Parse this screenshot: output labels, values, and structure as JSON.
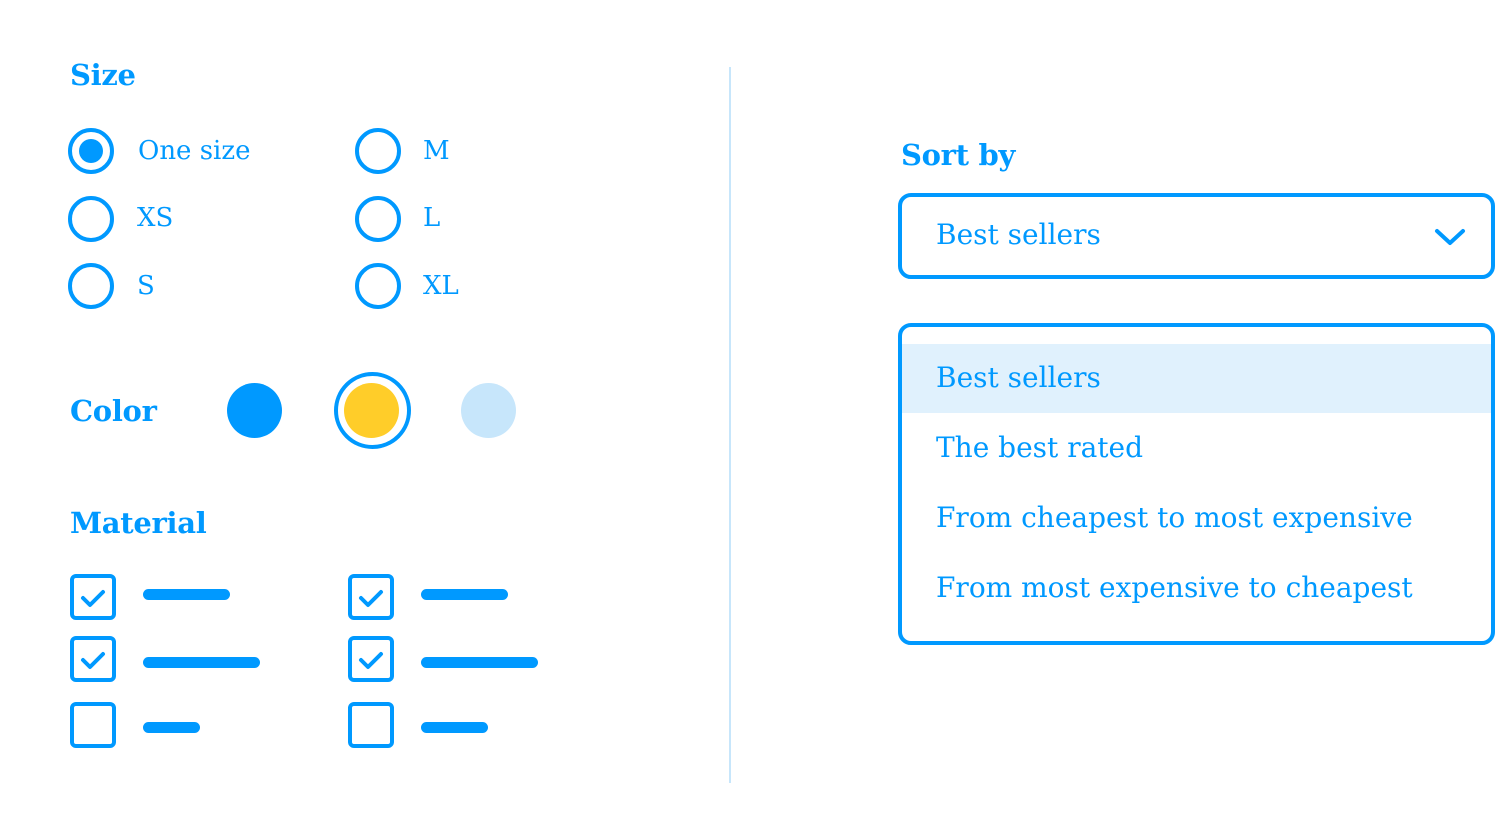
{
  "size": {
    "heading": "Size",
    "options": [
      {
        "label": "One size",
        "selected": true
      },
      {
        "label": "XS",
        "selected": false
      },
      {
        "label": "S",
        "selected": false
      },
      {
        "label": "M",
        "selected": false
      },
      {
        "label": "L",
        "selected": false
      },
      {
        "label": "XL",
        "selected": false
      }
    ]
  },
  "color": {
    "heading": "Color",
    "swatches": [
      {
        "name": "blue",
        "hex": "#0099ff",
        "selected": false
      },
      {
        "name": "yellow",
        "hex": "#ffcd29",
        "selected": true
      },
      {
        "name": "light-blue",
        "hex": "#c7e6fb",
        "selected": false
      }
    ]
  },
  "material": {
    "heading": "Material",
    "options": [
      {
        "checked": true
      },
      {
        "checked": true
      },
      {
        "checked": false
      },
      {
        "checked": true
      },
      {
        "checked": true
      },
      {
        "checked": false
      }
    ]
  },
  "sort": {
    "heading": "Sort by",
    "selected": "Best sellers",
    "options": [
      {
        "label": "Best sellers",
        "highlighted": true
      },
      {
        "label": "The best rated",
        "highlighted": false
      },
      {
        "label": "From cheapest to most expensive",
        "highlighted": false
      },
      {
        "label": "From most expensive to cheapest",
        "highlighted": false
      }
    ]
  },
  "colors": {
    "accent": "#0099ff",
    "divider": "#c7e6fb",
    "highlight": "#e0f1fd"
  }
}
